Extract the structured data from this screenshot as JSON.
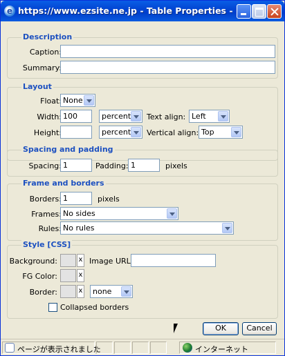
{
  "window": {
    "title": "https://www.ezsite.ne.jp - Table Properties -..."
  },
  "description": {
    "legend": "Description",
    "caption_label": "Caption:",
    "caption_value": "",
    "summary_label": "Summary:",
    "summary_value": ""
  },
  "layout": {
    "legend": "Layout",
    "float_label": "Float:",
    "float_value": "None",
    "width_label": "Width:",
    "width_value": "100",
    "width_unit": "percent",
    "text_align_label": "Text align:",
    "text_align_value": "Left",
    "height_label": "Height:",
    "height_value": "",
    "height_unit": "percent",
    "vertical_align_label": "Vertical align:",
    "vertical_align_value": "Top"
  },
  "spacing": {
    "legend": "Spacing and padding",
    "spacing_label": "Spacing:",
    "spacing_value": "1",
    "padding_label": "Padding:",
    "padding_value": "1",
    "unit": "pixels"
  },
  "frame": {
    "legend": "Frame and borders",
    "borders_label": "Borders:",
    "borders_value": "1",
    "borders_unit": "pixels",
    "frames_label": "Frames:",
    "frames_value": "No sides",
    "rules_label": "Rules:",
    "rules_value": "No rules"
  },
  "style": {
    "legend": "Style [CSS]",
    "background_label": "Background:",
    "image_url_label": "Image URL:",
    "image_url_value": "",
    "fg_color_label": "FG Color:",
    "border_label": "Border:",
    "border_style_value": "none",
    "collapsed_label": "Collapsed borders",
    "collapsed_checked": false,
    "clear_glyph": "x"
  },
  "buttons": {
    "ok": "OK",
    "cancel": "Cancel"
  },
  "statusbar": {
    "status_text": "ページが表示されました",
    "zone_text": "インターネット"
  },
  "colors": {
    "accent": "#1c50c0",
    "titlebar": "#0246d3"
  }
}
